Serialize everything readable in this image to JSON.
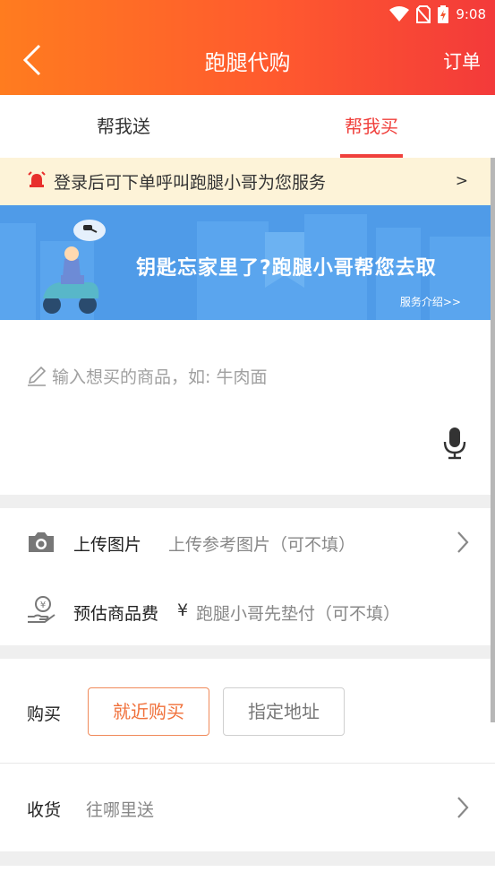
{
  "status_bar": {
    "time": "9:08"
  },
  "header": {
    "title": "跑腿代购",
    "orders_label": "订单"
  },
  "tabs": [
    {
      "label": "帮我送",
      "active": false
    },
    {
      "label": "帮我买",
      "active": true
    }
  ],
  "notice": {
    "text": "登录后可下单呼叫跑腿小哥为您服务",
    "arrow": ">"
  },
  "banner": {
    "slogan": "钥匙忘家里了?跑腿小哥帮您去取",
    "intro_link": "服务介绍>>"
  },
  "goods_input": {
    "placeholder": "输入想买的商品，如: 牛肉面"
  },
  "upload": {
    "label": "上传图片",
    "hint": "上传参考图片（可不填）"
  },
  "estimate": {
    "label": "预估商品费",
    "currency": "¥",
    "hint": "跑腿小哥先垫付（可不填）"
  },
  "buy": {
    "label": "购买",
    "options": [
      "就近购买",
      "指定地址"
    ],
    "selected": "就近购买"
  },
  "receive": {
    "label": "收货",
    "hint": "往哪里送"
  },
  "colors": {
    "accent": "#f0403c",
    "header_start": "#ff7c1f",
    "header_end": "#f33a3a",
    "banner": "#4f9be8",
    "notice_bg": "#fdf3d8"
  }
}
